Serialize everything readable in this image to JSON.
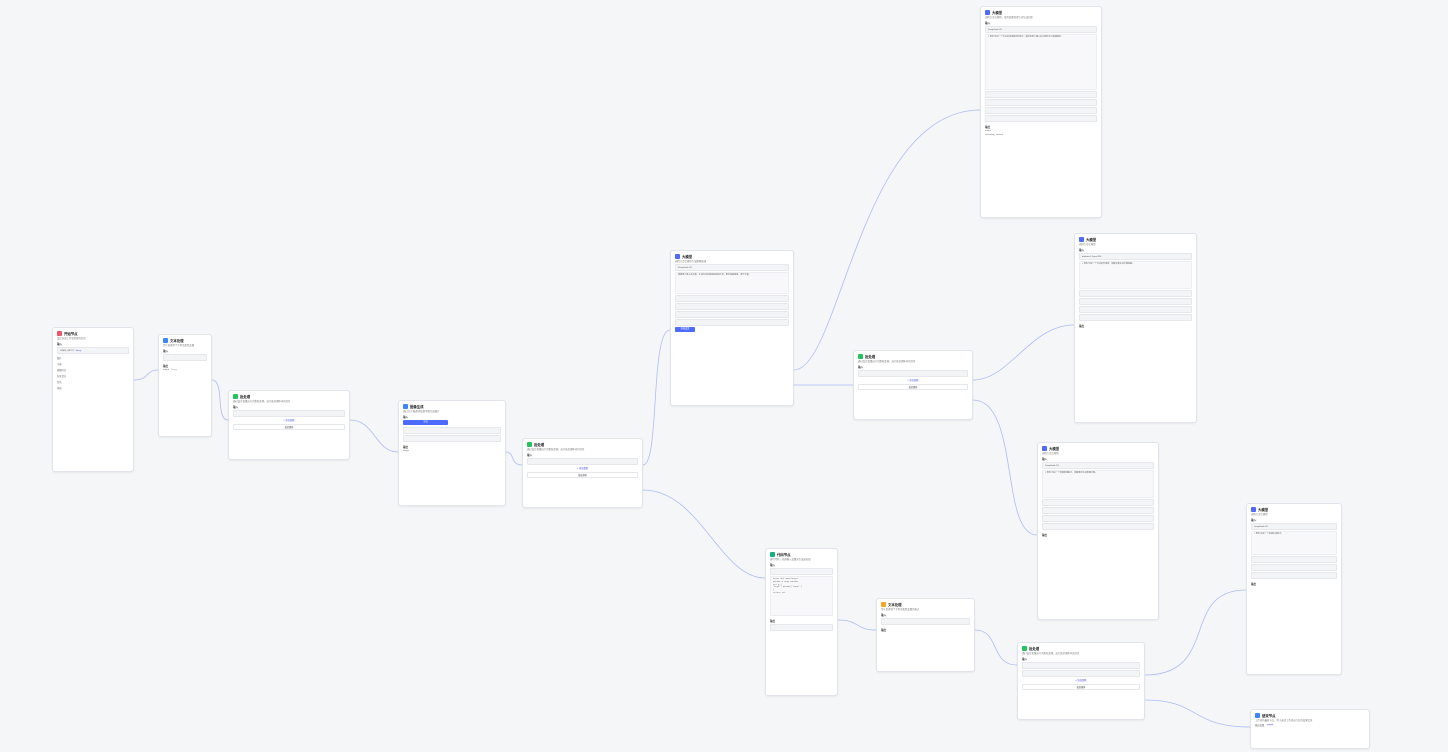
{
  "colors": {
    "edge": "#a9bdf7",
    "accent": "#4d53e8",
    "start": "#f0566a",
    "batch": "#21c45d",
    "llm": "#4d6bfe",
    "code": "#19b07a",
    "end": "#3a86ff",
    "text_node": "#f5a623"
  },
  "nodes": {
    "start": {
      "title": "开始节点",
      "desc": "设定启动工作流需要的信息",
      "input_label": "输入",
      "var_name": "USER_INPUT",
      "var_type": "String",
      "fields": [
        "图片",
        "字幕",
        "视频时长",
        "背景音乐",
        "音色",
        "风格"
      ]
    },
    "textproc": {
      "title": "文本处理",
      "desc": "用于处理多个字符串类型变量",
      "input_label": "输入",
      "output_label": "输出",
      "fields": [
        "output",
        "String"
      ]
    },
    "batch1": {
      "title": "批处理",
      "desc": "通过设定批量运行次数和逻辑，运行批处理体内的任务",
      "input_label": "输入",
      "add_label": "+ 添加参数",
      "end_label": "批处理体"
    },
    "image_gen": {
      "title": "图像生成",
      "desc": "通过文字描述/添加参考图生成图片",
      "input_label": "输入",
      "btn_label": "生成",
      "output_label": "输出",
      "out_var": "image"
    },
    "batch2": {
      "title": "批处理",
      "desc": "通过设定批量运行次数和逻辑，运行批处理体内的任务",
      "input_label": "输入",
      "add_label": "+ 添加参数",
      "end_label": "批处理体"
    },
    "llm_top": {
      "title": "大模型",
      "desc": "调用大语言模型，使用变量和提示词生成回复",
      "model": "DeepSeek-V3",
      "input_label": "输入",
      "output_label": "输出",
      "prompt": "# 角色\n你是一个专业的短视频创作助手，擅长将用户输入的内容转化为视频脚本。",
      "out_vars": [
        "output",
        "reasoning_content"
      ]
    },
    "llm_mid": {
      "title": "大模型",
      "desc": "调用大语言模型生成图像描述",
      "model": "DeepSeek-V3",
      "prompt": "根据用户输入的文案，生成对应的画面描述提示词，要求画面感强，细节丰富。",
      "btn_label": "添加变量"
    },
    "batch3": {
      "title": "批处理",
      "desc": "通过设定批量运行次数和逻辑，运行批处理体内的任务",
      "input_label": "输入",
      "add_label": "+ 添加参数",
      "end_label": "批处理体"
    },
    "llm_right1": {
      "title": "大模型",
      "desc": "调用大语言模型",
      "model": "doubao-1.5-pro-32k",
      "input_label": "输入",
      "output_label": "输出",
      "prompt": "# 角色\n你是一个专业的分镜师，根据文案生成分镜画面。"
    },
    "llm_right2": {
      "title": "大模型",
      "desc": "调用大语言模型",
      "model": "DeepSeek-V3",
      "input_label": "输入",
      "output_label": "输出",
      "prompt": "# 角色\n你是一个视频剪辑助手，根据素材生成剪辑方案。"
    },
    "code": {
      "title": "代码节点",
      "desc": "编写代码，处理输入变量来生成返回值",
      "input_label": "输入",
      "output_label": "输出",
      "code_lines": [
        "async def main(args):",
        "  params = args.params",
        "  ret = {",
        "    \"key0\": params['input']",
        "  }",
        "  return ret"
      ]
    },
    "text_node": {
      "title": "文本处理",
      "desc": "用于处理多个字符串类型变量的格式",
      "input_label": "输入",
      "output_label": "输出"
    },
    "batch4": {
      "title": "批处理",
      "desc": "通过设定批量运行次数和逻辑，运行批处理体内的任务",
      "input_label": "输入",
      "add_label": "+ 添加参数",
      "end_label": "批处理体"
    },
    "llm_right3": {
      "title": "大模型",
      "desc": "调用大语言模型",
      "model": "DeepSeek-V3",
      "input_label": "输入",
      "output_label": "输出",
      "prompt": "# 角色\n你是一个音频生成助手。"
    },
    "end": {
      "title": "结束节点",
      "desc": "工作流的最终节点，用于返回工作流运行后的结果信息",
      "input_label": "输出变量",
      "var_name": "output"
    }
  }
}
